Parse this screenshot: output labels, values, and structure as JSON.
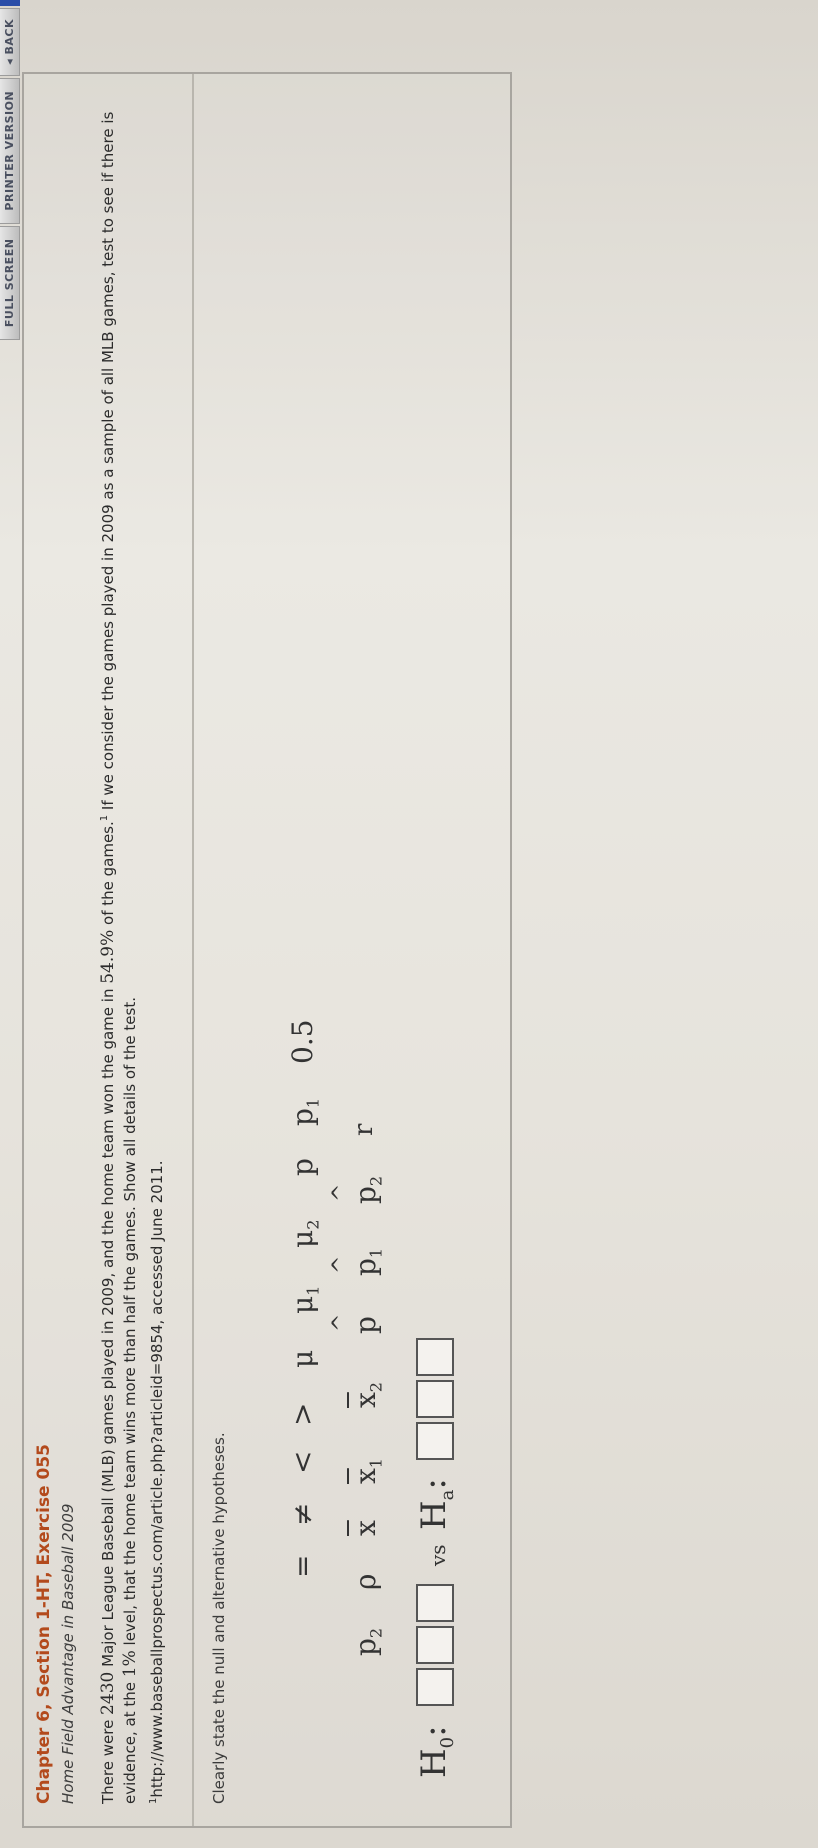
{
  "toolbar": {
    "back_label": "◂ BACK",
    "printer_label": "PRINTER VERSION",
    "fullscreen_label": "FULL SCREEN"
  },
  "problem": {
    "title": "Chapter 6, Section 1-HT, Exercise 055",
    "subtitle": "Home Field Advantage in Baseball 2009",
    "text_part1": "There were ",
    "games_count": "2430",
    "text_part2": " Major League Baseball (MLB) games played in 2009, and the home team won the game in ",
    "home_win_pct": "54.9%",
    "text_part3": " of the games.",
    "footnote_mark": "1",
    "text_part4": " If we consider the games played in 2009 as a sample of all MLB games, test to see if there is evidence, at the ",
    "alpha": "1%",
    "text_part5": " level, that the home team wins more than half the games. Show all details of the test.",
    "footnote": "http://www.baseballprospectus.com/article.php?articleid=9854, accessed June 2011."
  },
  "hypotheses": {
    "prompt": "Clearly state the null and alternative hypotheses.",
    "h0_label": "H",
    "h0_sub": "0",
    "ha_label": "H",
    "ha_sub": "a",
    "vs_label": "vs"
  },
  "palette": {
    "operators": [
      "=",
      "≠",
      "<",
      ">"
    ],
    "params": [
      "μ",
      "μ1",
      "μ2",
      "p",
      "p1",
      "0.5",
      "p2",
      "ρ",
      "x̄",
      "x̄1",
      "x̄2",
      "p̂",
      "p̂1",
      "p̂2",
      "r"
    ]
  }
}
